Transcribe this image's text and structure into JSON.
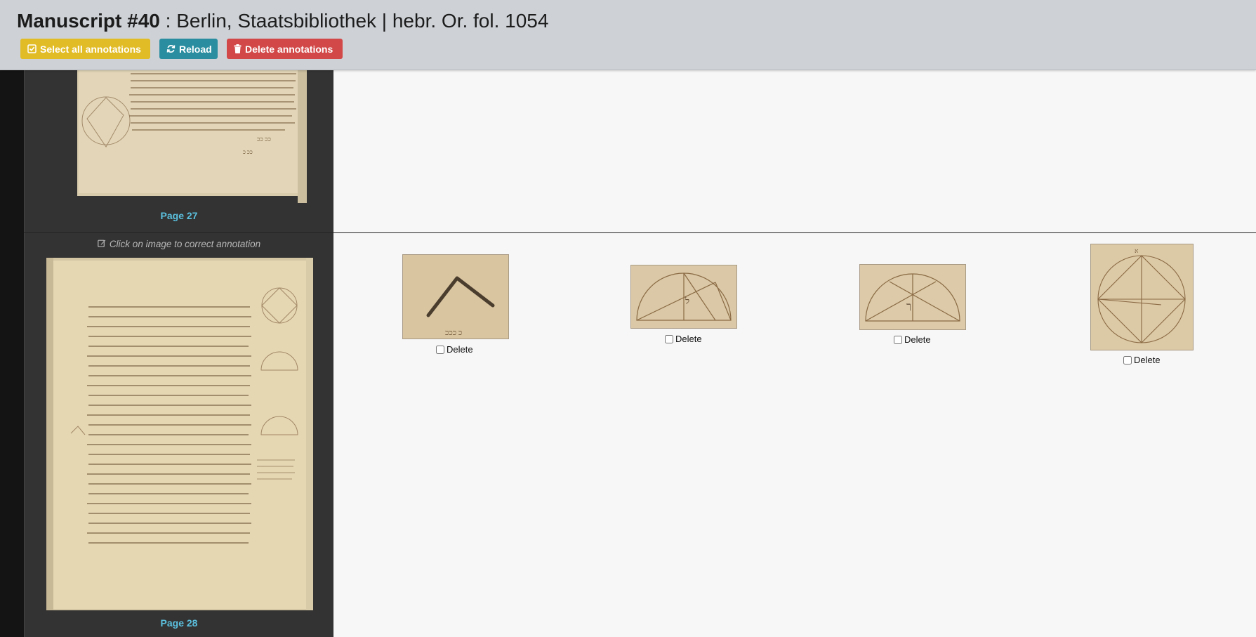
{
  "header": {
    "title_bold": "Manuscript #40",
    "title_rest": " : Berlin, Staatsbibliothek | hebr. Or. fol. 1054",
    "buttons": {
      "select_all": "Select all annotations",
      "reload": "Reload",
      "delete": "Delete annotations"
    },
    "colors": {
      "select_all": "#e2bc26",
      "reload": "#2a8ea0",
      "delete": "#d24848"
    }
  },
  "pages": [
    {
      "label": "Page 27"
    },
    {
      "label": "Page 28",
      "hint": "Click on image to correct annotation"
    }
  ],
  "annotations": [
    {
      "delete_label": "Delete",
      "icon": "diagram-angle"
    },
    {
      "delete_label": "Delete",
      "icon": "diagram-semicircle"
    },
    {
      "delete_label": "Delete",
      "icon": "diagram-semicircle"
    },
    {
      "delete_label": "Delete",
      "icon": "diagram-circle-square"
    }
  ]
}
